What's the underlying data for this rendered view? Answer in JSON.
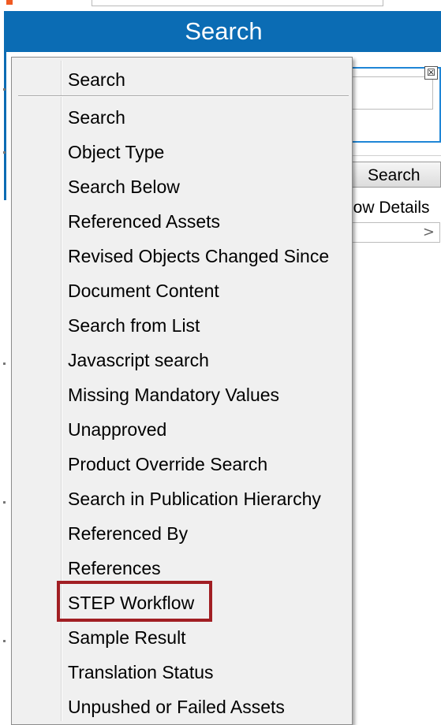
{
  "header": {
    "title": "Search"
  },
  "background": {
    "close_glyph": "☒",
    "search_button": "Search",
    "show_details": "how Details",
    "combo_arrow": ">"
  },
  "menu": {
    "header_label": "Search",
    "items": [
      {
        "label": "Search"
      },
      {
        "label": "Object Type"
      },
      {
        "label": "Search Below"
      },
      {
        "label": "Referenced Assets"
      },
      {
        "label": "Revised Objects Changed Since"
      },
      {
        "label": "Document Content"
      },
      {
        "label": "Search from List"
      },
      {
        "label": "Javascript search"
      },
      {
        "label": "Missing Mandatory Values"
      },
      {
        "label": "Unapproved"
      },
      {
        "label": "Product Override Search"
      },
      {
        "label": "Search in Publication Hierarchy"
      },
      {
        "label": "Referenced By"
      },
      {
        "label": "References"
      },
      {
        "label": "STEP Workflow",
        "highlighted": true
      },
      {
        "label": "Sample Result"
      },
      {
        "label": "Translation Status"
      },
      {
        "label": "Unpushed or Failed Assets"
      }
    ]
  },
  "colors": {
    "header_blue": "#0b6cb4",
    "menu_bg": "#f0f0f0",
    "highlight_border": "#a11e23",
    "input_focus": "#1f86d6"
  }
}
